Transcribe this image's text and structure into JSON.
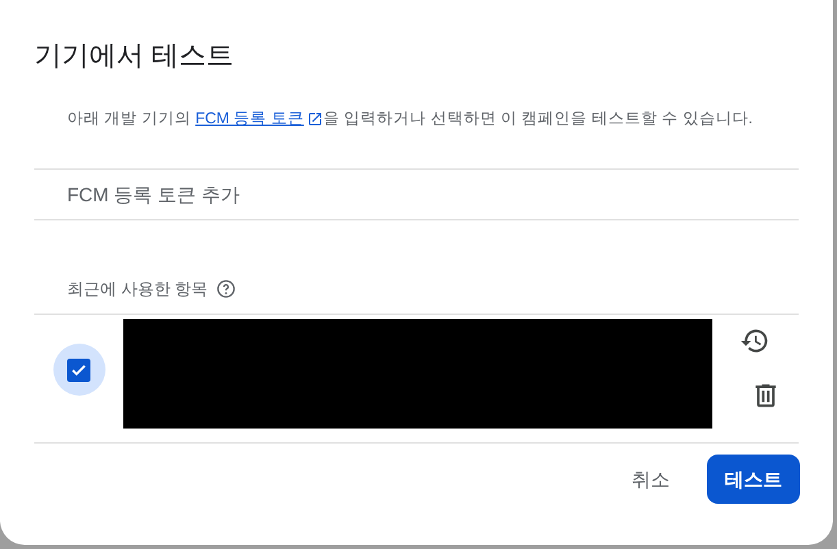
{
  "dialog": {
    "title": "기기에서 테스트"
  },
  "description": {
    "before": "아래 개발 기기의",
    "link": "FCM 등록 토큰",
    "after": "을 입력하거나 선택하면 이 캠페인을 테스트할 수 있습니다."
  },
  "token_field": {
    "placeholder": "FCM 등록 토큰 추가"
  },
  "recent": {
    "label": "최근에 사용한 항목",
    "items": [
      {
        "checked": true
      }
    ]
  },
  "buttons": [
    {
      "label": "취소",
      "kind": "text"
    },
    {
      "label": "테스트",
      "kind": "primary"
    }
  ]
}
